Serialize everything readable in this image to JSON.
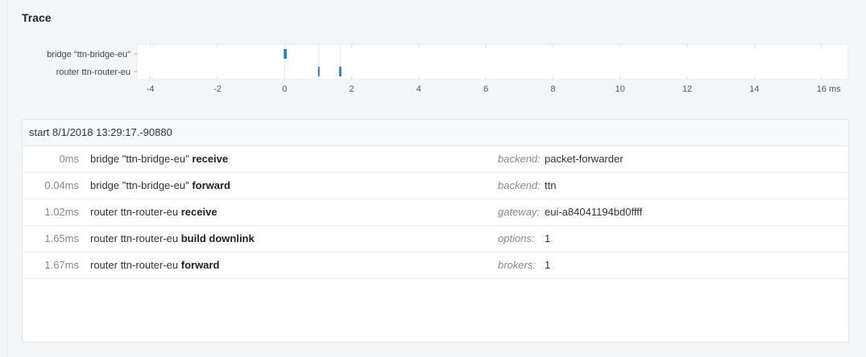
{
  "title": "Trace",
  "chart_data": {
    "type": "timeline",
    "rows": [
      "bridge \"ttn-bridge-eu\"",
      "router ttn-router-eu"
    ],
    "x_ticks": [
      -4,
      -2,
      0,
      2,
      4,
      6,
      8,
      10,
      12,
      14,
      16
    ],
    "x_unit": "ms",
    "xlim": [
      -4.4,
      16.8
    ],
    "events": [
      {
        "row": 0,
        "t": 0.0
      },
      {
        "row": 0,
        "t": 0.04
      },
      {
        "row": 1,
        "t": 1.02
      },
      {
        "row": 1,
        "t": 1.65
      },
      {
        "row": 1,
        "t": 1.67
      }
    ],
    "markers": [
      0,
      1.02,
      1.67
    ],
    "accent": "#1f86c8"
  },
  "panel": {
    "header": "start 8/1/2018 13:29:17.-90880",
    "rows": [
      {
        "time": "0ms",
        "subject": "bridge \"ttn-bridge-eu\"",
        "action": "receive",
        "key": "backend:",
        "value": "packet-forwarder"
      },
      {
        "time": "0.04ms",
        "subject": "bridge \"ttn-bridge-eu\"",
        "action": "forward",
        "key": "backend:",
        "value": "ttn"
      },
      {
        "time": "1.02ms",
        "subject": "router ttn-router-eu",
        "action": "receive",
        "key": "gateway:",
        "value": "eui-a84041194bd0ffff"
      },
      {
        "time": "1.65ms",
        "subject": "router ttn-router-eu",
        "action": "build downlink",
        "key": "options:",
        "value": "1"
      },
      {
        "time": "1.67ms",
        "subject": "router ttn-router-eu",
        "action": "forward",
        "key": "brokers:",
        "value": "1"
      }
    ]
  }
}
